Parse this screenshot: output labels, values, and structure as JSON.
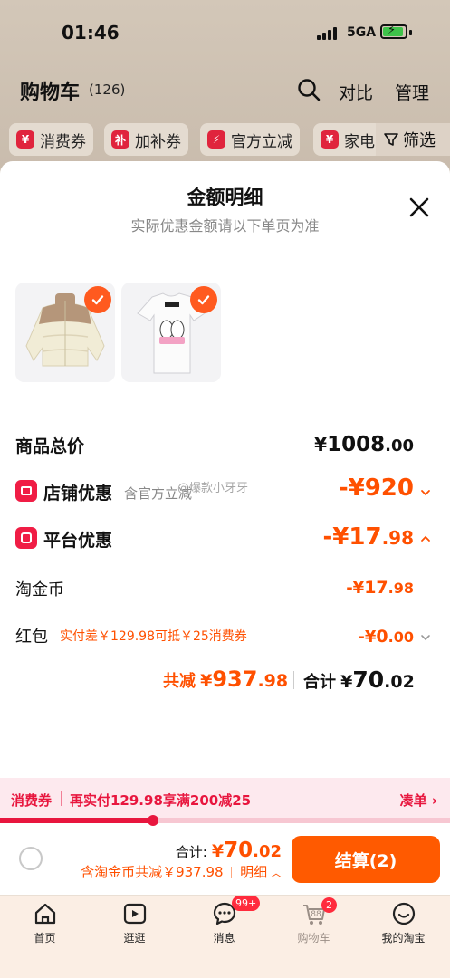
{
  "status_bar": {
    "time": "01:46",
    "network": "5GA"
  },
  "cart_header": {
    "title": "购物车",
    "count": "(126)",
    "compare": "对比",
    "manage": "管理"
  },
  "filters": {
    "chips": [
      {
        "badge": "¥",
        "label": "消费券"
      },
      {
        "badge": "补",
        "label": "加补券"
      },
      {
        "badge": "⚡",
        "label": "官方立减"
      },
      {
        "badge": "¥",
        "label": "家电"
      }
    ],
    "filter_label": "筛选"
  },
  "sheet": {
    "title": "金额明细",
    "subtitle": "实际优惠金额请以下单页为准",
    "items": [
      {
        "name": "puffer-jacket"
      },
      {
        "name": "white-tshirt"
      }
    ],
    "rows": {
      "total": {
        "label": "商品总价",
        "currency": "¥",
        "int": "1008",
        "dec": ".00"
      },
      "shop": {
        "label": "店铺优惠",
        "note": "含官方立减",
        "prefix": "-¥",
        "int": "920"
      },
      "platform": {
        "label": "平台优惠",
        "prefix": "-¥",
        "int": "17",
        "dec": ".98"
      },
      "coins": {
        "label": "淘金币",
        "prefix": "-¥",
        "int": "17",
        "dec": ".98"
      },
      "redpack": {
        "label": "红包",
        "note": "实付差￥129.98可抵￥25消费券",
        "prefix": "-¥",
        "int": "0",
        "dec": ".00"
      }
    },
    "summary": {
      "saved_label": "共减",
      "saved_currency": "¥",
      "saved_int": "937",
      "saved_dec": ".98",
      "total_label": "合计",
      "total_currency": "¥",
      "total_int": "70",
      "total_dec": ".02"
    },
    "watermark": "@爆款小牙牙"
  },
  "coupon_bar": {
    "label": "消费券",
    "text": "再实付129.98享满200减25",
    "link": "凑单",
    "progress": 0.34
  },
  "checkout": {
    "total_label": "合计:",
    "total_currency": "¥",
    "total_int": "70",
    "total_dec": ".02",
    "saved_text": "含淘金币共减￥937.98",
    "detail_link": "明细",
    "button_label": "结算(2)"
  },
  "tab_bar": {
    "tabs": [
      {
        "label": "首页",
        "icon": "home-icon"
      },
      {
        "label": "逛逛",
        "icon": "play-icon"
      },
      {
        "label": "消息",
        "icon": "message-icon",
        "badge": "99+"
      },
      {
        "label": "购物车",
        "icon": "cart-icon",
        "badge": "2",
        "inner": "88"
      },
      {
        "label": "我的淘宝",
        "icon": "smile-icon"
      }
    ]
  },
  "colors": {
    "accent": "#ff5000",
    "brand_red": "#e8163e",
    "button": "#ff5a00"
  }
}
